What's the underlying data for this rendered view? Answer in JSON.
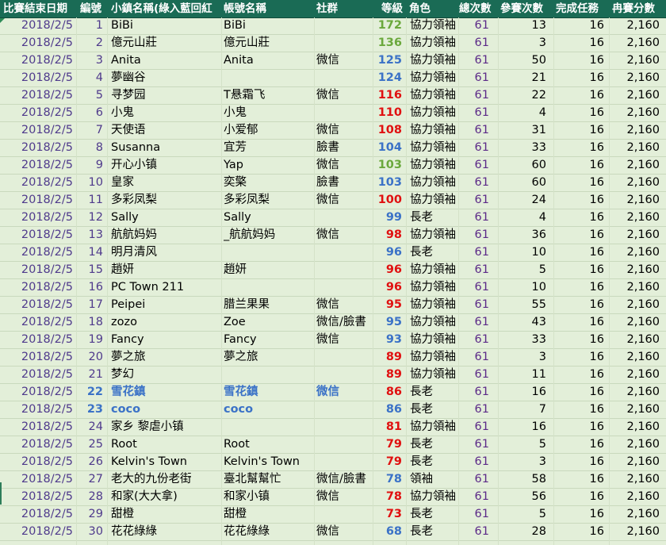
{
  "headers": {
    "date": "比賽結束日期",
    "no": "編號",
    "town": "小鎮名稱(綠入藍回紅",
    "account": "帳號名稱",
    "social": "社群",
    "level": "等級",
    "role": "角色",
    "total": "總次數",
    "participate": "參賽次數",
    "tasks": "完成任務",
    "score": "冉賽分數"
  },
  "colors": {
    "green": "#6aa83c",
    "blue": "#3b72c7",
    "red": "#e01010",
    "header_bg": "#1a6b55",
    "row_bg": "#e3efd9"
  },
  "rows": [
    {
      "date": "2018/2/5",
      "no": "1",
      "town": "BiBi",
      "account": "BiBi",
      "social": "",
      "level": "172",
      "level_color": "green",
      "role": "協力領袖",
      "total": "61",
      "participate": "13",
      "tasks": "16",
      "score": "2,160",
      "highlight": false
    },
    {
      "date": "2018/2/5",
      "no": "2",
      "town": "億元山莊",
      "account": "億元山莊",
      "social": "",
      "level": "136",
      "level_color": "green",
      "role": "協力領袖",
      "total": "61",
      "participate": "3",
      "tasks": "16",
      "score": "2,160",
      "highlight": false
    },
    {
      "date": "2018/2/5",
      "no": "3",
      "town": "Anita",
      "account": "Anita",
      "social": "微信",
      "level": "125",
      "level_color": "blue",
      "role": "協力領袖",
      "total": "61",
      "participate": "50",
      "tasks": "16",
      "score": "2,160",
      "highlight": false
    },
    {
      "date": "2018/2/5",
      "no": "4",
      "town": "夢幽谷",
      "account": "",
      "social": "",
      "level": "124",
      "level_color": "blue",
      "role": "協力領袖",
      "total": "61",
      "participate": "21",
      "tasks": "16",
      "score": "2,160",
      "highlight": false
    },
    {
      "date": "2018/2/5",
      "no": "5",
      "town": "寻梦园",
      "account": "T悬霜飞",
      "social": "微信",
      "level": "116",
      "level_color": "red",
      "role": "協力領袖",
      "total": "61",
      "participate": "22",
      "tasks": "16",
      "score": "2,160",
      "highlight": false
    },
    {
      "date": "2018/2/5",
      "no": "6",
      "town": "小鬼",
      "account": "小鬼",
      "social": "",
      "level": "110",
      "level_color": "red",
      "role": "協力領袖",
      "total": "61",
      "participate": "4",
      "tasks": "16",
      "score": "2,160",
      "highlight": false
    },
    {
      "date": "2018/2/5",
      "no": "7",
      "town": "天使语",
      "account": "小爱郁",
      "social": "微信",
      "level": "108",
      "level_color": "red",
      "role": "協力領袖",
      "total": "61",
      "participate": "31",
      "tasks": "16",
      "score": "2,160",
      "highlight": false
    },
    {
      "date": "2018/2/5",
      "no": "8",
      "town": "Susanna",
      "account": "宜芳",
      "social": "臉書",
      "level": "104",
      "level_color": "blue",
      "role": "協力領袖",
      "total": "61",
      "participate": "33",
      "tasks": "16",
      "score": "2,160",
      "highlight": false
    },
    {
      "date": "2018/2/5",
      "no": "9",
      "town": "开心小镇",
      "account": "Yap",
      "social": "微信",
      "level": "103",
      "level_color": "green",
      "role": "協力領袖",
      "total": "61",
      "participate": "60",
      "tasks": "16",
      "score": "2,160",
      "highlight": false
    },
    {
      "date": "2018/2/5",
      "no": "10",
      "town": "皇家",
      "account": "奕檠",
      "social": "臉書",
      "level": "103",
      "level_color": "blue",
      "role": "協力領袖",
      "total": "61",
      "participate": "60",
      "tasks": "16",
      "score": "2,160",
      "highlight": false
    },
    {
      "date": "2018/2/5",
      "no": "11",
      "town": "多彩凤梨",
      "account": "多彩凤梨",
      "social": "微信",
      "level": "100",
      "level_color": "red",
      "role": "協力領袖",
      "total": "61",
      "participate": "24",
      "tasks": "16",
      "score": "2,160",
      "highlight": false
    },
    {
      "date": "2018/2/5",
      "no": "12",
      "town": "Sally",
      "account": "Sally",
      "social": "",
      "level": "99",
      "level_color": "blue",
      "role": "長老",
      "total": "61",
      "participate": "4",
      "tasks": "16",
      "score": "2,160",
      "highlight": false
    },
    {
      "date": "2018/2/5",
      "no": "13",
      "town": "航航妈妈",
      "account": "_航航妈妈",
      "social": "微信",
      "level": "98",
      "level_color": "red",
      "role": "協力領袖",
      "total": "61",
      "participate": "36",
      "tasks": "16",
      "score": "2,160",
      "highlight": false
    },
    {
      "date": "2018/2/5",
      "no": "14",
      "town": "明月清风",
      "account": "",
      "social": "",
      "level": "96",
      "level_color": "blue",
      "role": "長老",
      "total": "61",
      "participate": "10",
      "tasks": "16",
      "score": "2,160",
      "highlight": false
    },
    {
      "date": "2018/2/5",
      "no": "15",
      "town": "趙妍",
      "account": "趙妍",
      "social": "",
      "level": "96",
      "level_color": "red",
      "role": "協力領袖",
      "total": "61",
      "participate": "5",
      "tasks": "16",
      "score": "2,160",
      "highlight": false
    },
    {
      "date": "2018/2/5",
      "no": "16",
      "town": "PC Town 211",
      "account": "",
      "social": "",
      "level": "96",
      "level_color": "red",
      "role": "協力領袖",
      "total": "61",
      "participate": "10",
      "tasks": "16",
      "score": "2,160",
      "highlight": false
    },
    {
      "date": "2018/2/5",
      "no": "17",
      "town": "Peipei",
      "account": "腊兰果果",
      "social": "微信",
      "level": "95",
      "level_color": "red",
      "role": "協力領袖",
      "total": "61",
      "participate": "55",
      "tasks": "16",
      "score": "2,160",
      "highlight": false
    },
    {
      "date": "2018/2/5",
      "no": "18",
      "town": "zozo",
      "account": "Zoe",
      "social": "微信/臉書",
      "level": "95",
      "level_color": "blue",
      "role": "協力領袖",
      "total": "61",
      "participate": "43",
      "tasks": "16",
      "score": "2,160",
      "highlight": false
    },
    {
      "date": "2018/2/5",
      "no": "19",
      "town": "Fancy",
      "account": "Fancy",
      "social": "微信",
      "level": "93",
      "level_color": "blue",
      "role": "協力領袖",
      "total": "61",
      "participate": "33",
      "tasks": "16",
      "score": "2,160",
      "highlight": false
    },
    {
      "date": "2018/2/5",
      "no": "20",
      "town": "夢之旅",
      "account": "夢之旅",
      "social": "",
      "level": "89",
      "level_color": "red",
      "role": "協力領袖",
      "total": "61",
      "participate": "3",
      "tasks": "16",
      "score": "2,160",
      "highlight": false
    },
    {
      "date": "2018/2/5",
      "no": "21",
      "town": "梦幻",
      "account": "",
      "social": "",
      "level": "89",
      "level_color": "red",
      "role": "協力領袖",
      "total": "61",
      "participate": "11",
      "tasks": "16",
      "score": "2,160",
      "highlight": false
    },
    {
      "date": "2018/2/5",
      "no": "22",
      "town": "雪花鎮",
      "account": "雪花鎮",
      "social": "微信",
      "level": "86",
      "level_color": "red",
      "role": "長老",
      "total": "61",
      "participate": "16",
      "tasks": "16",
      "score": "2,160",
      "highlight": true
    },
    {
      "date": "2018/2/5",
      "no": "23",
      "town": "coco",
      "account": "coco",
      "social": "",
      "level": "86",
      "level_color": "blue",
      "role": "長老",
      "total": "61",
      "participate": "7",
      "tasks": "16",
      "score": "2,160",
      "highlight": true
    },
    {
      "date": "2018/2/5",
      "no": "24",
      "town": "家乡 黎虐小镇",
      "account": "",
      "social": "",
      "level": "81",
      "level_color": "red",
      "role": "協力領袖",
      "total": "61",
      "participate": "16",
      "tasks": "16",
      "score": "2,160",
      "highlight": false
    },
    {
      "date": "2018/2/5",
      "no": "25",
      "town": "Root",
      "account": "Root",
      "social": "",
      "level": "79",
      "level_color": "red",
      "role": "長老",
      "total": "61",
      "participate": "5",
      "tasks": "16",
      "score": "2,160",
      "highlight": false
    },
    {
      "date": "2018/2/5",
      "no": "26",
      "town": "Kelvin's Town",
      "account": "Kelvin's Town",
      "social": "",
      "level": "79",
      "level_color": "red",
      "role": "長老",
      "total": "61",
      "participate": "3",
      "tasks": "16",
      "score": "2,160",
      "highlight": false
    },
    {
      "date": "2018/2/5",
      "no": "27",
      "town": "老大的九份老街",
      "account": "臺北幫幫忙",
      "social": "微信/臉書",
      "level": "78",
      "level_color": "blue",
      "role": "領袖",
      "total": "61",
      "participate": "58",
      "tasks": "16",
      "score": "2,160",
      "highlight": false
    },
    {
      "date": "2018/2/5",
      "no": "28",
      "town": "和家(大大拿)",
      "account": "和家小镇",
      "social": "微信",
      "level": "78",
      "level_color": "red",
      "role": "協力領袖",
      "total": "61",
      "participate": "56",
      "tasks": "16",
      "score": "2,160",
      "highlight": false
    },
    {
      "date": "2018/2/5",
      "no": "29",
      "town": "甜橙",
      "account": "甜橙",
      "social": "",
      "level": "73",
      "level_color": "red",
      "role": "長老",
      "total": "61",
      "participate": "5",
      "tasks": "16",
      "score": "2,160",
      "highlight": false
    },
    {
      "date": "2018/2/5",
      "no": "30",
      "town": "花花綠綠",
      "account": "花花綠綠",
      "social": "微信",
      "level": "68",
      "level_color": "blue",
      "role": "長老",
      "total": "61",
      "participate": "28",
      "tasks": "16",
      "score": "2,160",
      "highlight": false
    }
  ]
}
